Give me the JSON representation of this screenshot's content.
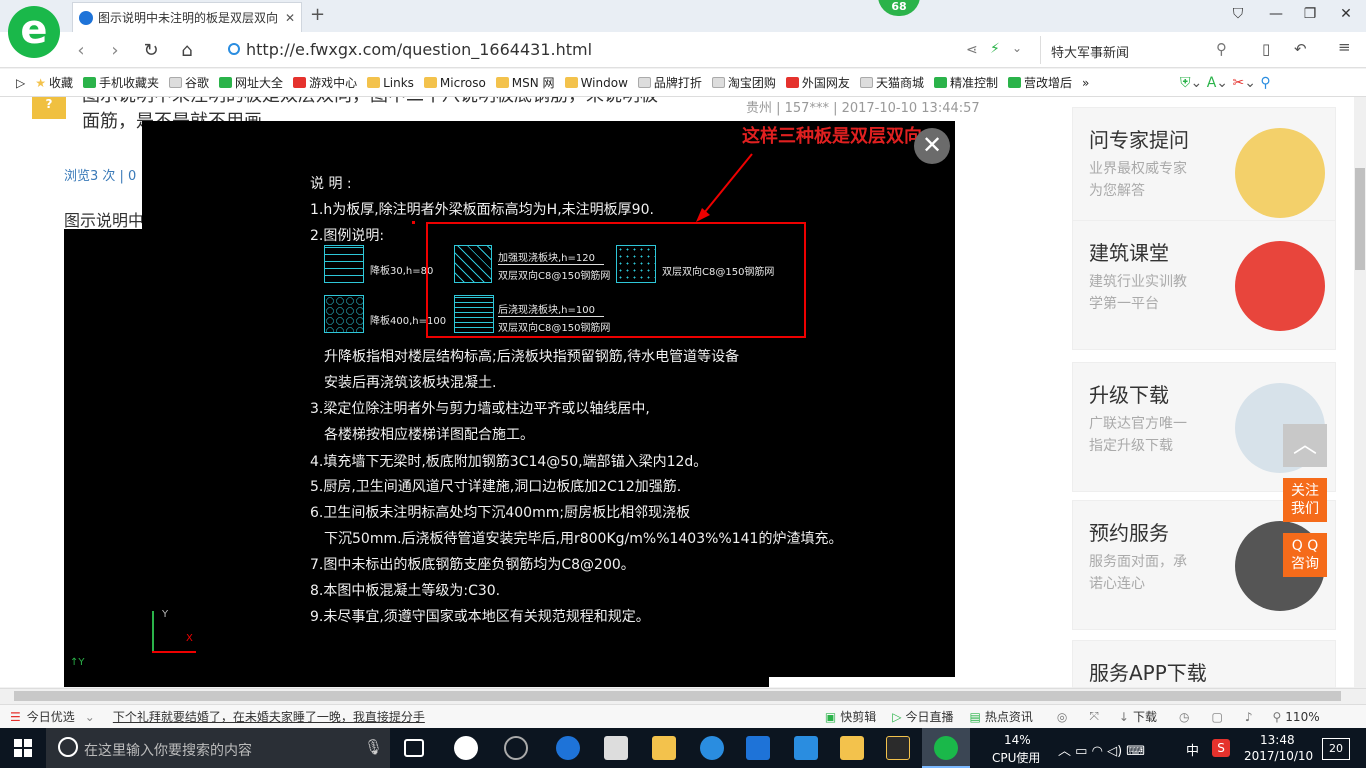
{
  "browser": {
    "tab_title": "图示说明中未注明的板是双层双向",
    "url": "http://e.fwxgx.com/question_1664431.html",
    "badge": "68",
    "search_text": "特大军事新闻"
  },
  "bookmarks": [
    "收藏",
    "手机收藏夹",
    "谷歌",
    "网址大全",
    "游戏中心",
    "Links",
    "Microso",
    "MSN 网",
    "Window",
    "品牌打折",
    "淘宝团购",
    "外国网友",
    "天猫商城",
    "精准控制",
    "营改增后"
  ],
  "page": {
    "q_icon": "?",
    "title_line1": "图示说明中未注明的板是双层双向，图中二十八说明板底钢筋，未说明板",
    "title_line2": "面筋，是不是就不用画",
    "asker": "贵州 | 157*** | 2017-10-10 13:44:57",
    "views": "浏览3 次 | 0",
    "desc": "图示说明中"
  },
  "sidebar": [
    {
      "title": "问专家提问",
      "line1": "业界最权威专家",
      "line2": "为您解答",
      "color": "#f3d06a"
    },
    {
      "title": "建筑课堂",
      "line1": "建筑行业实训教",
      "line2": "学第一平台",
      "color": "#e8453c"
    },
    {
      "title": "升级下载",
      "line1": "广联达官方唯一",
      "line2": "指定升级下载",
      "color": "#d7e2ea"
    },
    {
      "title": "预约服务",
      "line1": "服务面对面，承",
      "line2": "诺心连心",
      "color": "#555"
    },
    {
      "title": "服务APP下载",
      "line1": "",
      "line2": "",
      "color": "#222"
    }
  ],
  "float": {
    "follow1": "关注",
    "follow2": "我们",
    "qq1": "Q Q",
    "qq2": "咨询"
  },
  "viewer": {
    "annotation": "这样三种板是双层双向",
    "lines": [
      "说 明 :",
      "1.h为板厚,除注明者外梁板面标高均为H,未注明板厚90.",
      "2.图例说明:",
      "升降板指相对楼层结构标高;后浇板块指预留钢筋,待水电管道等设备",
      "安装后再浇筑该板块混凝土.",
      "3.梁定位除注明者外与剪力墙或柱边平齐或以轴线居中,",
      "各楼梯按相应楼梯详图配合施工。",
      "4.填充墙下无梁时,板底附加钢筋3C14@50,端部锚入梁内12d。",
      "5.厨房,卫生间通风道尺寸详建施,洞口边板底加2C12加强筋.",
      "6.卫生间板未注明标高处均下沉400mm;厨房板比相邻现浇板",
      "下沉50mm.后浇板待管道安装完毕后,用r800Kg/m%%1403%%141的炉渣填充。",
      "7.图中未标出的板底钢筋支座负钢筋均为C8@200。",
      "8.本图中板混凝土等级为:C30.",
      "9.未尽事宜,须遵守国家或本地区有关规范规程和规定。"
    ],
    "legend": {
      "l1": "降板30,h=80",
      "l2": "降板400,h=100",
      "l3a": "加强现浇板块,h=120",
      "l3b": "双层双向C8@150钢筋网",
      "l4a": "后浇现浇板块,h=100",
      "l4b": "双层双向C8@150钢筋网",
      "l5": "双层双向C8@150钢筋网"
    },
    "axis_y": "Y",
    "axis_x": "X"
  },
  "status": {
    "today": "今日优选",
    "news": "下个礼拜就要结婚了，在未婚夫家睡了一晚，我直接提分手",
    "kuaijianji": "快剪辑",
    "live": "今日直播",
    "hot": "热点资讯",
    "download": "下载",
    "zoom": "110%"
  },
  "taskbar": {
    "search_placeholder": "在这里输入你要搜索的内容",
    "cpu_pct": "14%",
    "cpu_label": "CPU使用",
    "ime": "中",
    "time": "13:48",
    "date": "2017/10/10",
    "notif": "20"
  }
}
